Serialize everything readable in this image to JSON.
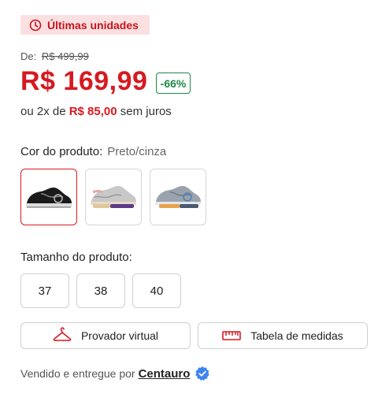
{
  "badge": {
    "label": "Últimas unidades",
    "icon": "clock-icon",
    "color": "#c8141c",
    "background": "#fbe0e1"
  },
  "pricing": {
    "old_prefix": "De:",
    "old_price": "R$ 499,99",
    "price": "R$ 169,99",
    "discount": "-66%",
    "installments_prefix": "ou 2x de",
    "installment_value": "R$ 85,00",
    "installments_suffix": "sem juros",
    "price_color": "#d71920",
    "discount_color": "#1e8a46"
  },
  "color": {
    "label": "Cor do produto:",
    "selected": "Preto/cinza",
    "options": [
      {
        "name": "shoe-black",
        "selected": true
      },
      {
        "name": "shoe-grey-purple",
        "selected": false
      },
      {
        "name": "shoe-grey-blue",
        "selected": false
      }
    ]
  },
  "size": {
    "label": "Tamanho do produto:",
    "options": [
      "37",
      "38",
      "40"
    ]
  },
  "actions": {
    "fitting": {
      "label": "Provador virtual",
      "icon": "hanger-icon"
    },
    "size_chart": {
      "label": "Tabela de medidas",
      "icon": "ruler-icon"
    }
  },
  "seller": {
    "prefix": "Vendido e entregue por",
    "name": "Centauro",
    "icon": "verified-badge-icon"
  }
}
